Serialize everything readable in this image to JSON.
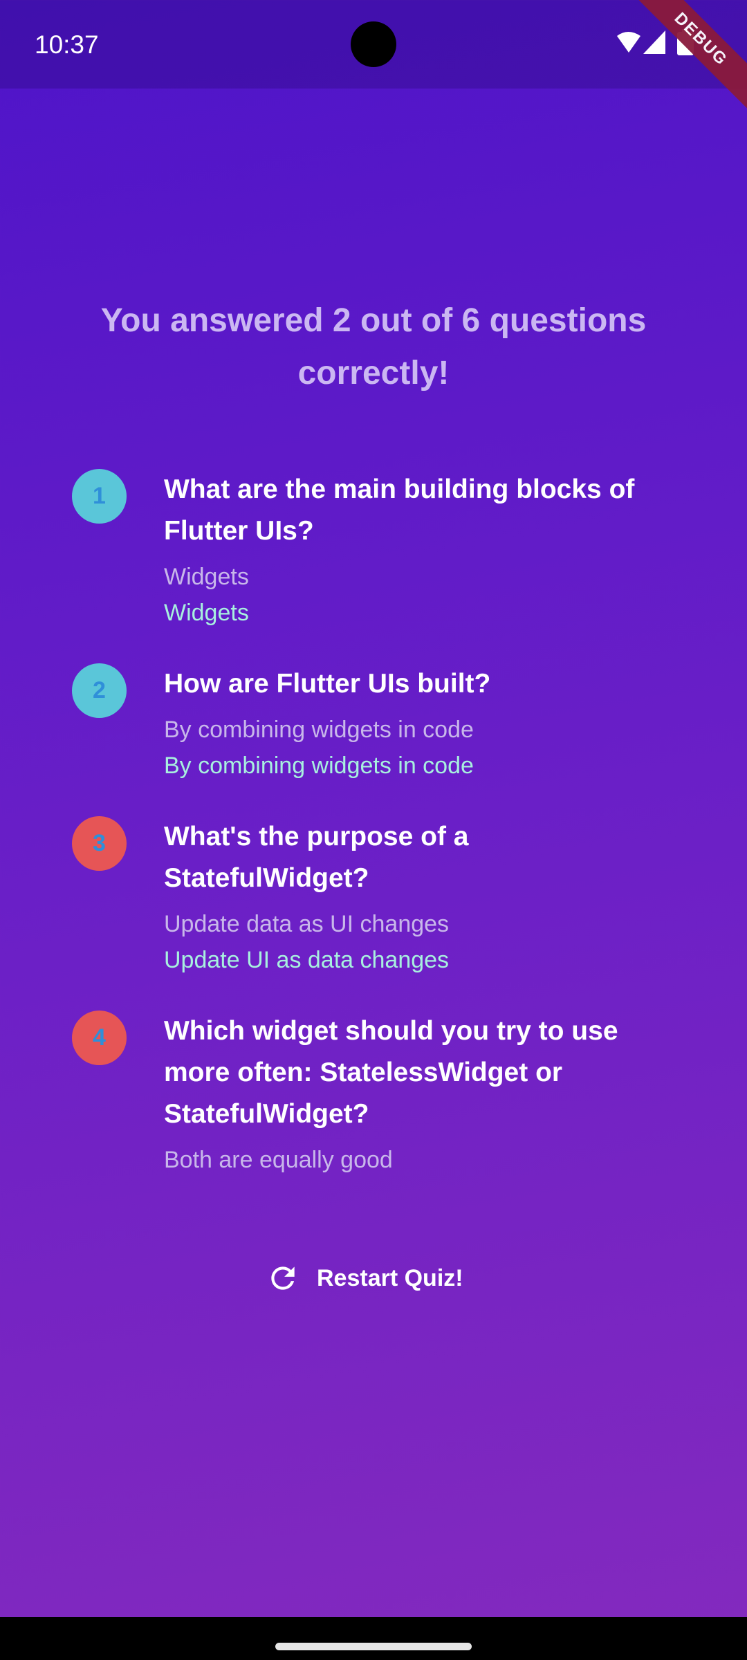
{
  "status_bar": {
    "time": "10:37",
    "icons": [
      "wifi-icon",
      "cellular-signal-icon",
      "battery-icon"
    ]
  },
  "debug_banner": "DEBUG",
  "results": {
    "title": "You answered 2 out of 6 questions correctly!",
    "items": [
      {
        "index": "1",
        "question": "What are the main building blocks of Flutter UIs?",
        "user_answer": "Widgets",
        "correct_answer": "Widgets",
        "is_correct": true
      },
      {
        "index": "2",
        "question": "How are Flutter UIs built?",
        "user_answer": "By combining widgets in code",
        "correct_answer": "By combining widgets in code",
        "is_correct": true
      },
      {
        "index": "3",
        "question": "What's the purpose of a StatefulWidget?",
        "user_answer": "Update data as UI changes",
        "correct_answer": "Update UI as data changes",
        "is_correct": false
      },
      {
        "index": "4",
        "question": "Which widget should you try to use more often: StatelessWidget or StatefulWidget?",
        "user_answer": "Both are equally good",
        "correct_answer": "",
        "is_correct": false
      }
    ]
  },
  "restart_button": {
    "label": "Restart Quiz!",
    "icon": "refresh-icon"
  },
  "colors": {
    "background_top": "#4e14c9",
    "background_bottom": "#842abe",
    "badge_correct": "#5ac6d9",
    "badge_wrong": "#e65556",
    "correct_answer_text": "#a8f0df",
    "user_answer_text": "#c8b7ea"
  }
}
